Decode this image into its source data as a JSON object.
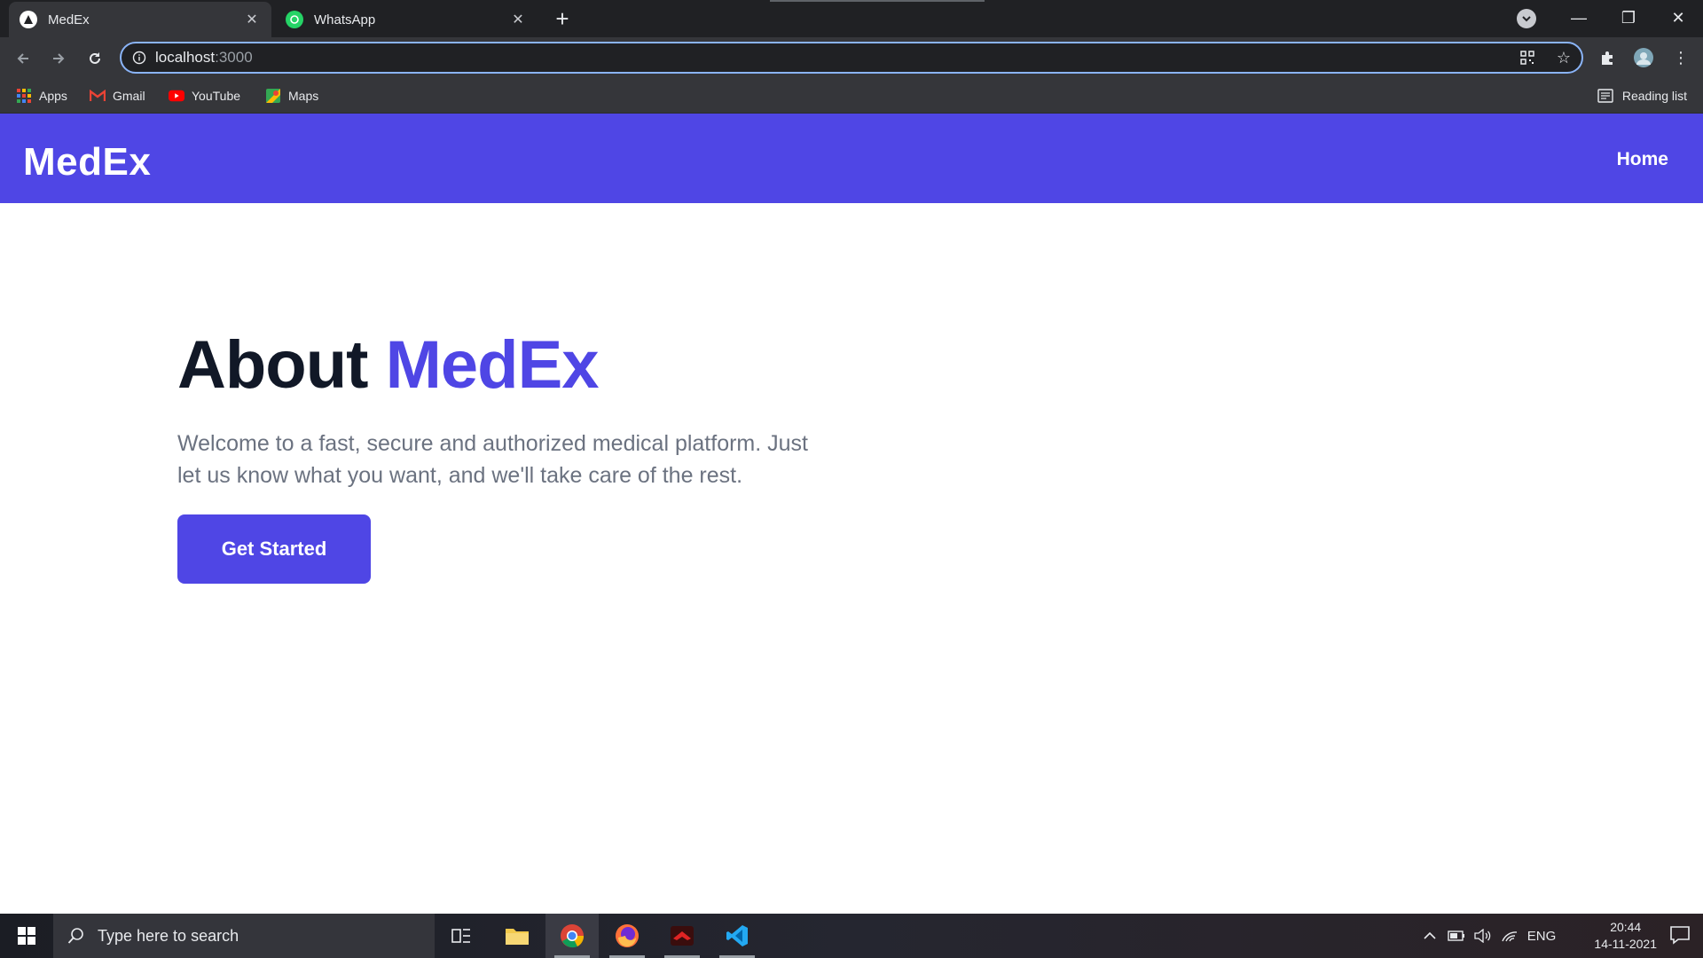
{
  "browser": {
    "tabs": [
      {
        "title": "MedEx",
        "active": true
      },
      {
        "title": "WhatsApp",
        "active": false
      }
    ],
    "address": {
      "host": "localhost",
      "port": ":3000"
    },
    "bookmarks": [
      {
        "label": "Apps"
      },
      {
        "label": "Gmail"
      },
      {
        "label": "YouTube"
      },
      {
        "label": "Maps"
      }
    ],
    "reading_list": "Reading list"
  },
  "site": {
    "brand": "MedEx",
    "nav": {
      "home": "Home"
    },
    "hero": {
      "title_plain": "About",
      "title_accent": "MedEx",
      "description": "Welcome to a fast, secure and authorized medical platform. Just let us know what you want, and we'll take care of the rest.",
      "cta": "Get Started"
    },
    "colors": {
      "primary": "#4f46e5",
      "heading": "#111827",
      "body_text": "#6b7280"
    }
  },
  "taskbar": {
    "search_placeholder": "Type here to search",
    "language": "ENG",
    "time": "20:44",
    "date": "14-11-2021"
  }
}
